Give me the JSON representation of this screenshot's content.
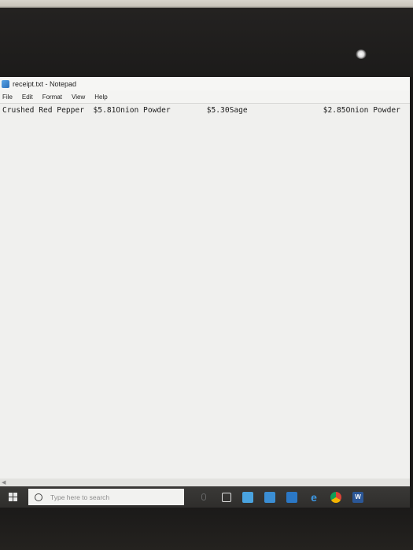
{
  "window": {
    "title": "receipt.txt - Notepad"
  },
  "menu": {
    "items": [
      "File",
      "Edit",
      "Format",
      "View",
      "Help"
    ]
  },
  "document": {
    "segments": [
      "Crushed Red Pepper  $5.81Onion Powder",
      "$5.30Sage",
      "$2.85Onion Powder"
    ]
  },
  "taskbar": {
    "search_placeholder": "Type here to search",
    "word_letter": "W",
    "edge_letter": "e"
  },
  "colors": {
    "taskbar": "#2f2e2c",
    "editor_bg": "#f0f0ee",
    "edge": "#3d9ae8",
    "word": "#2b5797"
  },
  "icons": {
    "start": "windows-logo-icon",
    "search": "search-circle-icon",
    "mic": "microphone-icon",
    "task_view": "task-view-icon",
    "store": "store-icon",
    "files": "file-explorer-icon",
    "mail": "mail-icon",
    "edge": "edge-icon",
    "chrome": "chrome-icon",
    "word": "word-icon"
  }
}
